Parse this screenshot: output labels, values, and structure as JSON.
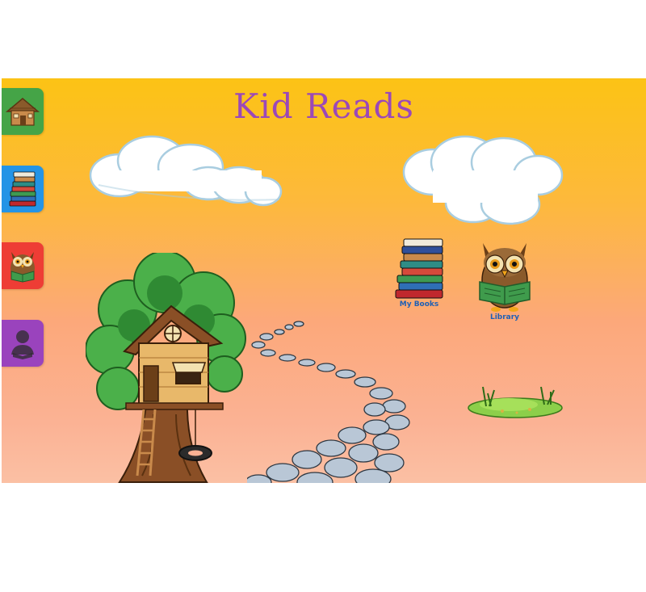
{
  "app": {
    "title": "Kid Reads"
  },
  "side_nav": [
    {
      "id": "home",
      "icon": "treehouse-hut-icon",
      "color": "#45a447"
    },
    {
      "id": "books",
      "icon": "book-stack-icon",
      "color": "#2494e6"
    },
    {
      "id": "library",
      "icon": "reading-owl-icon",
      "color": "#ee3d35"
    },
    {
      "id": "profile",
      "icon": "reader-person-icon",
      "color": "#9a43bd"
    }
  ],
  "scene": {
    "items": [
      {
        "id": "my-books",
        "label": "My Books",
        "icon": "book-stack-icon"
      },
      {
        "id": "library",
        "label": "Library",
        "icon": "reading-owl-icon"
      }
    ]
  },
  "colors": {
    "title": "#9b48b8",
    "label": "#1f60b5",
    "sky_top": "#fcc315",
    "sky_bottom": "#fbc0a4"
  }
}
